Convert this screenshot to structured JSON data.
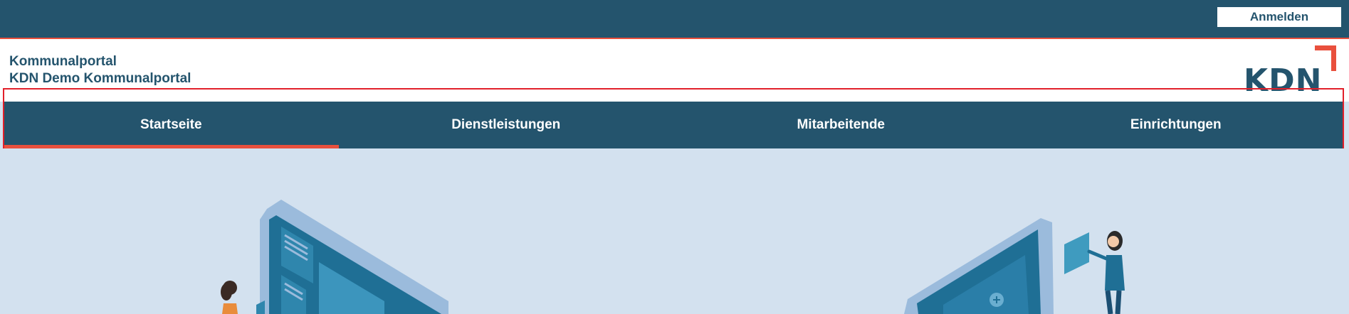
{
  "topbar": {
    "login_label": "Anmelden"
  },
  "header": {
    "portal_name": "Kommunalportal",
    "portal_subtitle": "KDN Demo Kommunalportal",
    "logo_text": "KDN"
  },
  "nav": {
    "items": [
      {
        "label": "Startseite",
        "active": true
      },
      {
        "label": "Dienstleistungen",
        "active": false
      },
      {
        "label": "Mitarbeitende",
        "active": false
      },
      {
        "label": "Einrichtungen",
        "active": false
      }
    ]
  },
  "colors": {
    "brand": "#24546d",
    "accent": "#e9503d",
    "hero_bg": "#d3e1ef",
    "highlight": "#e2202a"
  },
  "hero": {
    "illustration_left": "monitor-with-person-illustration",
    "illustration_right": "screen-with-presenter-illustration"
  }
}
